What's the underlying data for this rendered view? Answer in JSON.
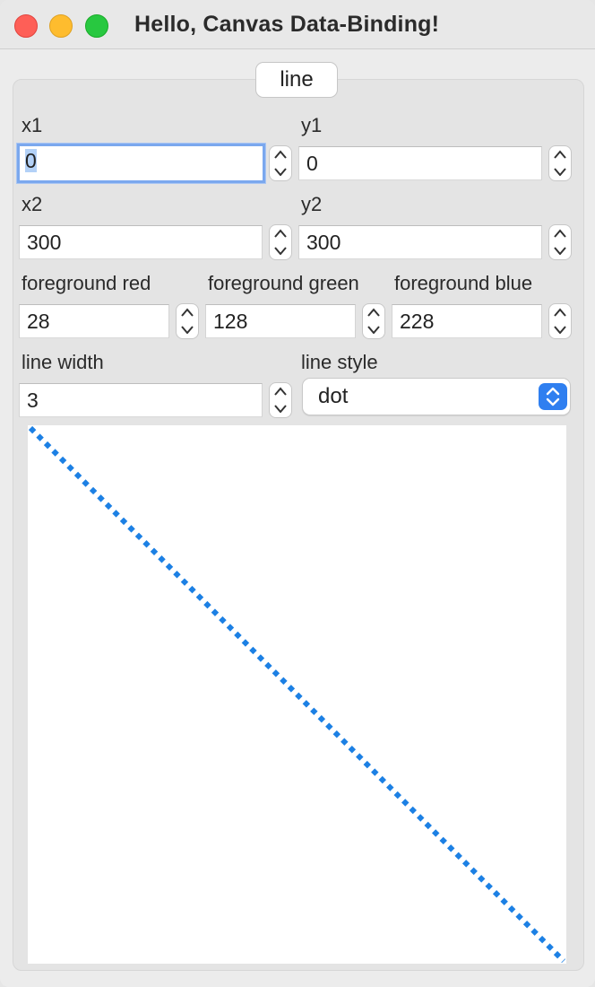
{
  "window": {
    "title": "Hello, Canvas Data-Binding!"
  },
  "tab": {
    "label": "line"
  },
  "fields": {
    "x1": {
      "label": "x1",
      "value": "0"
    },
    "y1": {
      "label": "y1",
      "value": "0"
    },
    "x2": {
      "label": "x2",
      "value": "300"
    },
    "y2": {
      "label": "y2",
      "value": "300"
    },
    "fg_red": {
      "label": "foreground red",
      "value": "28"
    },
    "fg_green": {
      "label": "foreground green",
      "value": "128"
    },
    "fg_blue": {
      "label": "foreground blue",
      "value": "228"
    },
    "line_width": {
      "label": "line width",
      "value": "3"
    },
    "line_style": {
      "label": "line style",
      "value": "dot"
    }
  },
  "line": {
    "color": "#1c80e4",
    "style": "dot",
    "width": 3
  }
}
